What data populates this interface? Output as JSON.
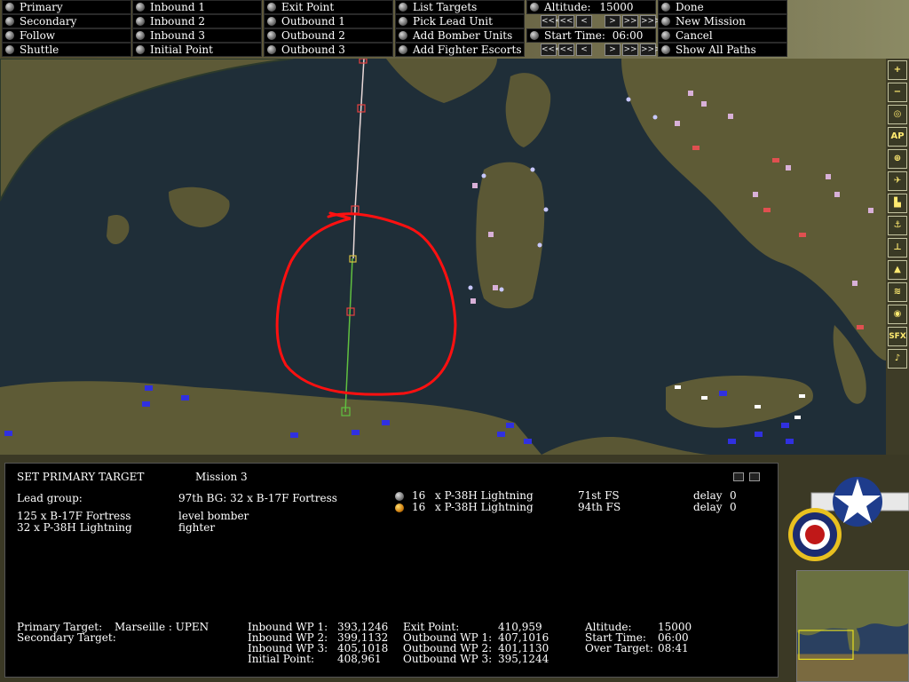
{
  "toolbar": {
    "col1": [
      "Primary",
      "Secondary",
      "Follow",
      "Shuttle"
    ],
    "col2": [
      "Inbound 1",
      "Inbound 2",
      "Inbound 3",
      "Initial Point"
    ],
    "col3": [
      "Exit Point",
      "Outbound 1",
      "Outbound 2",
      "Outbound 3"
    ],
    "col4": [
      "List Targets",
      "Pick Lead Unit",
      "Add Bomber Units",
      "Add Fighter Escorts"
    ],
    "altitude_label": "Altitude:",
    "altitude_value": "15000",
    "start_time_label": "Start Time:",
    "start_time_value": "06:00",
    "stepper_glyphs": [
      "<<<",
      "<<",
      "<",
      ">",
      ">>",
      ">>>"
    ],
    "col6": [
      "Done",
      "New Mission",
      "Cancel",
      "Show All Paths"
    ]
  },
  "right_toolbar": {
    "icons": [
      "zoom-in-icon",
      "zoom-out-icon",
      "target-reticle-icon",
      "ap-icon",
      "crosshair-icon",
      "plane-icon",
      "factory-icon",
      "anchor-icon",
      "airfield-icon",
      "building-icon",
      "ship-icon",
      "compass-icon",
      "sfx-icon",
      "music-icon"
    ],
    "ap_label": "AP",
    "sfx_label": "SFX"
  },
  "mission_panel": {
    "heading": "SET PRIMARY TARGET",
    "mission_label": "Mission 3",
    "lead_group_label": "Lead group:",
    "lead_group_value": "97th BG: 32 x B-17F Fortress",
    "forces": [
      {
        "qty": "125 x B-17F Fortress",
        "role": "level bomber"
      },
      {
        "qty": " 32  x P-38H Lightning",
        "role": "fighter"
      }
    ],
    "escorts": [
      {
        "count": "16",
        "type": "x P-38H Lightning",
        "unit": "71st FS",
        "delay_label": "delay",
        "delay": "0",
        "color": "#9a9a9a"
      },
      {
        "count": "16",
        "type": "x P-38H Lightning",
        "unit": "94th FS",
        "delay_label": "delay",
        "delay": "0",
        "color": "#e0a020"
      }
    ],
    "primary_target_label": "Primary Target:",
    "primary_target_value": "Marseille : UPEN",
    "secondary_target_label": "Secondary Target:",
    "waypoints_in": [
      {
        "label": "Inbound WP 1:",
        "value": "393,1246"
      },
      {
        "label": "Inbound WP 2:",
        "value": "399,1132"
      },
      {
        "label": "Inbound WP 3:",
        "value": "405,1018"
      },
      {
        "label": "Initial Point:",
        "value": "408,961"
      }
    ],
    "waypoints_out": [
      {
        "label": "Exit Point:",
        "value": "410,959"
      },
      {
        "label": "Outbound WP 1:",
        "value": "407,1016"
      },
      {
        "label": "Outbound WP 2:",
        "value": "401,1130"
      },
      {
        "label": "Outbound WP 3:",
        "value": "395,1244"
      }
    ],
    "summary": [
      {
        "label": "Altitude:",
        "value": "15000"
      },
      {
        "label": "Start Time:",
        "value": "06:00"
      },
      {
        "label": "Over Target:",
        "value": "08:41"
      }
    ]
  },
  "colors": {
    "sea": "#1e2d38",
    "land": "#5e5a36",
    "route_out": "#e8d8d8",
    "route_in": "#60c040",
    "annotation": "#ff1010",
    "toolbar_button": "#000000"
  }
}
